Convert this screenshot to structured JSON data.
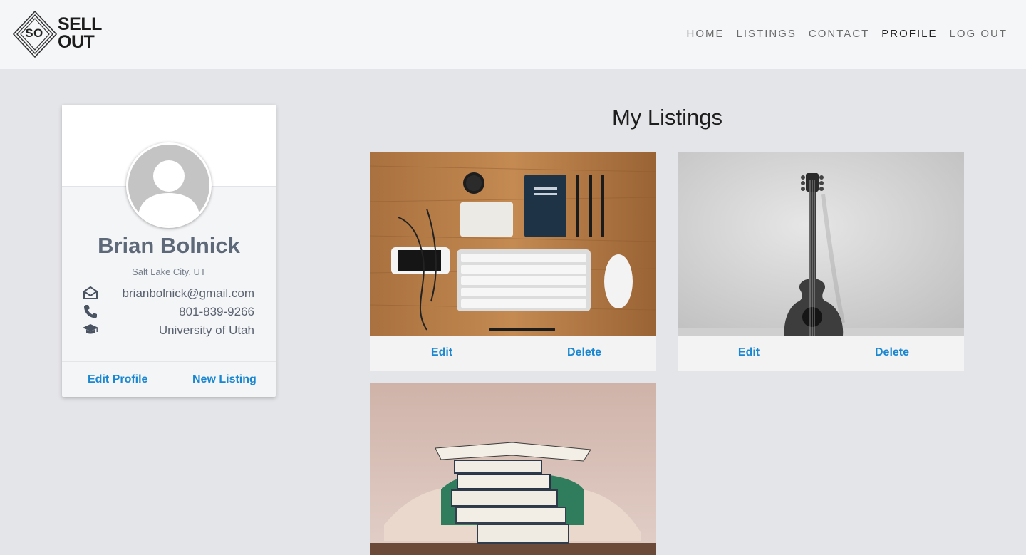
{
  "logo": {
    "mark": "SO",
    "line1": "SELL",
    "line2": "OUT"
  },
  "nav": {
    "items": [
      {
        "label": "HOME",
        "active": false
      },
      {
        "label": "LISTINGS",
        "active": false
      },
      {
        "label": "CONTACT",
        "active": false
      },
      {
        "label": "PROFILE",
        "active": true
      },
      {
        "label": "LOG OUT",
        "active": false
      }
    ]
  },
  "profile": {
    "name": "Brian Bolnick",
    "location": "Salt Lake City, UT",
    "email": "brianbolnick@gmail.com",
    "phone": "801-839-9266",
    "school": "University of Utah",
    "edit_label": "Edit Profile",
    "new_listing_label": "New Listing",
    "icons": [
      "envelope-icon",
      "phone-icon",
      "graduation-cap-icon"
    ]
  },
  "listings": {
    "title": "My Listings",
    "items": [
      {
        "image": "desk-flatlay-photo",
        "edit_label": "Edit",
        "delete_label": "Delete"
      },
      {
        "image": "guitar-photo",
        "edit_label": "Edit",
        "delete_label": "Delete"
      },
      {
        "image": "books-photo"
      }
    ]
  },
  "colors": {
    "accent": "#1a87d0",
    "page_bg": "#e4e5e8",
    "navbar_bg": "#f5f6f8",
    "name_color": "#5d6878"
  }
}
